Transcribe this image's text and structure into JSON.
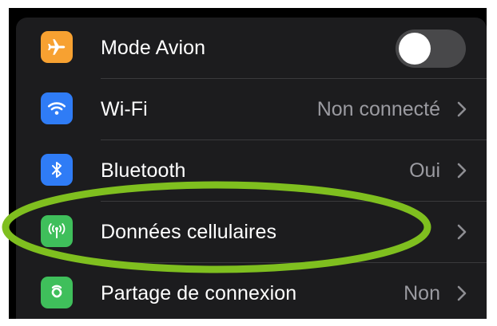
{
  "settings": {
    "rows": [
      {
        "label": "Mode Avion",
        "icon": "airplane-icon",
        "icon_bg": "#f7a131",
        "control": "toggle",
        "toggle_on": false
      },
      {
        "label": "Wi-Fi",
        "value": "Non connecté",
        "icon": "wifi-icon",
        "icon_bg": "#2f7cf6"
      },
      {
        "label": "Bluetooth",
        "value": "Oui",
        "icon": "bluetooth-icon",
        "icon_bg": "#2f7cf6"
      },
      {
        "label": "Données cellulaires",
        "value": "",
        "icon": "cellular-antenna-icon",
        "icon_bg": "#3fbf5b"
      },
      {
        "label": "Partage de connexion",
        "value": "Non",
        "icon": "hotspot-link-icon",
        "icon_bg": "#3fbf5b"
      }
    ]
  },
  "annotation": {
    "color": "#7fbf1f",
    "target": "Données cellulaires"
  }
}
